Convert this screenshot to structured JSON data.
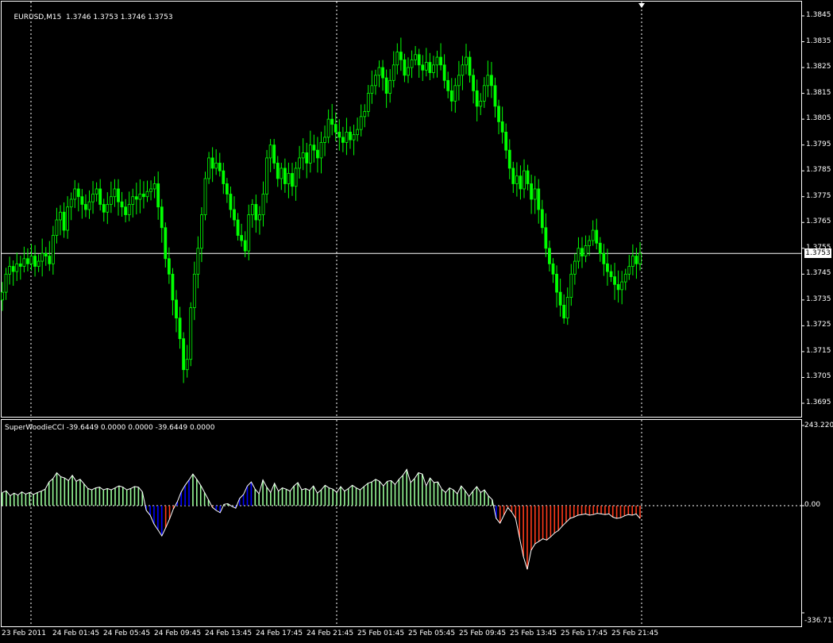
{
  "main": {
    "symbol_label": "EURUSD,M15",
    "ohlc_label": "1.3746 1.3753 1.3746 1.3753",
    "current_price": "1.3753",
    "price_ticks": [
      "1.3845",
      "1.3835",
      "1.3825",
      "1.3815",
      "1.3805",
      "1.3795",
      "1.3785",
      "1.3775",
      "1.3765",
      "1.3755",
      "1.3745",
      "1.3735",
      "1.3725",
      "1.3715",
      "1.3705",
      "1.3695"
    ],
    "price_min": 1.3691,
    "price_max": 1.3851,
    "candle_color": "#00ff00",
    "closes": [
      1.3738,
      1.3745,
      1.3748,
      1.3746,
      1.3749,
      1.3748,
      1.3751,
      1.3749,
      1.3752,
      1.3748,
      1.375,
      1.3753,
      1.3752,
      1.3749,
      1.376,
      1.3766,
      1.3769,
      1.3762,
      1.3771,
      1.3774,
      1.3778,
      1.3775,
      1.3772,
      1.377,
      1.3773,
      1.3776,
      1.3778,
      1.3772,
      1.3769,
      1.3772,
      1.3775,
      1.3778,
      1.3773,
      1.3771,
      1.3768,
      1.3772,
      1.3775,
      1.3774,
      1.3776,
      1.3775,
      1.3777,
      1.3778,
      1.378,
      1.3771,
      1.3763,
      1.3751,
      1.3745,
      1.3735,
      1.3728,
      1.372,
      1.3708,
      1.3712,
      1.3732,
      1.3745,
      1.3755,
      1.3768,
      1.3782,
      1.379,
      1.3786,
      1.3788,
      1.3785,
      1.378,
      1.3776,
      1.377,
      1.3766,
      1.376,
      1.3758,
      1.3754,
      1.3768,
      1.3772,
      1.3766,
      1.3768,
      1.3776,
      1.379,
      1.3795,
      1.3788,
      1.3782,
      1.3786,
      1.378,
      1.3784,
      1.3779,
      1.3786,
      1.379,
      1.3792,
      1.3788,
      1.3795,
      1.3793,
      1.379,
      1.3796,
      1.3798,
      1.3805,
      1.3803,
      1.38,
      1.3798,
      1.3796,
      1.38,
      1.3797,
      1.3799,
      1.3801,
      1.3806,
      1.3808,
      1.3815,
      1.3818,
      1.3822,
      1.3825,
      1.3821,
      1.3815,
      1.382,
      1.3826,
      1.3831,
      1.3828,
      1.3822,
      1.3825,
      1.3828,
      1.383,
      1.3826,
      1.3824,
      1.3827,
      1.3823,
      1.3826,
      1.3829,
      1.3826,
      1.382,
      1.3816,
      1.3812,
      1.3818,
      1.3822,
      1.3826,
      1.3829,
      1.3822,
      1.3816,
      1.381,
      1.3812,
      1.3818,
      1.3822,
      1.3818,
      1.381,
      1.3804,
      1.38,
      1.3793,
      1.3786,
      1.378,
      1.3783,
      1.3778,
      1.3785,
      1.378,
      1.3774,
      1.3778,
      1.377,
      1.3763,
      1.3755,
      1.3749,
      1.3745,
      1.3738,
      1.3733,
      1.3728,
      1.3736,
      1.3745,
      1.375,
      1.3755,
      1.3752,
      1.3756,
      1.3758,
      1.3762,
      1.3757,
      1.3753,
      1.3749,
      1.3746,
      1.3744,
      1.3741,
      1.3739,
      1.3742,
      1.3745,
      1.3748,
      1.3752,
      1.3749,
      1.3753
    ]
  },
  "indicator": {
    "name_label": "SuperWoodieCCI -39.6449 0.0000 0.0000 -39.6449 0.0000",
    "top_label": "243.2200",
    "zero_label": "0.00",
    "bottom_label": "-336.7112",
    "ymin": -336.7112,
    "ymax": 243.22,
    "colors": {
      "positive": "#98fb98",
      "negative_red": "#ff3a1a",
      "negative_blue": "#0000ff",
      "line": "#ffffff"
    },
    "values": [
      40,
      45,
      30,
      38,
      32,
      42,
      35,
      40,
      34,
      40,
      44,
      50,
      72,
      82,
      100,
      88,
      84,
      76,
      92,
      74,
      80,
      66,
      52,
      48,
      54,
      56,
      48,
      52,
      48,
      54,
      60,
      56,
      48,
      52,
      58,
      56,
      42,
      -15,
      -30,
      -58,
      -76,
      -95,
      -70,
      -42,
      -10,
      12,
      42,
      62,
      78,
      96,
      80,
      62,
      40,
      18,
      -5,
      -15,
      -22,
      4,
      6,
      -2,
      -8,
      22,
      34,
      60,
      72,
      50,
      36,
      78,
      56,
      40,
      68,
      44,
      54,
      50,
      44,
      60,
      70,
      48,
      52,
      46,
      60,
      38,
      48,
      62,
      54,
      50,
      40,
      58,
      44,
      52,
      62,
      54,
      48,
      58,
      68,
      72,
      80,
      74,
      60,
      74,
      76,
      64,
      80,
      92,
      110,
      70,
      82,
      100,
      96,
      60,
      84,
      70,
      72,
      50,
      40,
      54,
      48,
      36,
      60,
      46,
      28,
      44,
      58,
      40,
      48,
      30,
      18,
      -40,
      -55,
      -30,
      -6,
      -20,
      -40,
      -100,
      -160,
      -200,
      -140,
      -120,
      -112,
      -104,
      -108,
      -98,
      -86,
      -78,
      -64,
      -52,
      -40,
      -36,
      -30,
      -28,
      -26,
      -30,
      -28,
      -24,
      -26,
      -28,
      -26,
      -36,
      -40,
      -38,
      -32,
      -28,
      -30,
      -26,
      -40
    ],
    "neg_colors": "BBBBBRRRRBBBBBRRRRRRRRRRRRRRRRRRRRRRRRRRRRRRR"
  },
  "time_labels": [
    "23 Feb 2011",
    "24 Feb 01:45",
    "24 Feb 05:45",
    "24 Feb 09:45",
    "24 Feb 13:45",
    "24 Feb 17:45",
    "24 Feb 21:45",
    "25 Feb 01:45",
    "25 Feb 05:45",
    "25 Feb 09:45",
    "25 Feb 13:45",
    "25 Feb 17:45",
    "25 Feb 21:45"
  ]
}
